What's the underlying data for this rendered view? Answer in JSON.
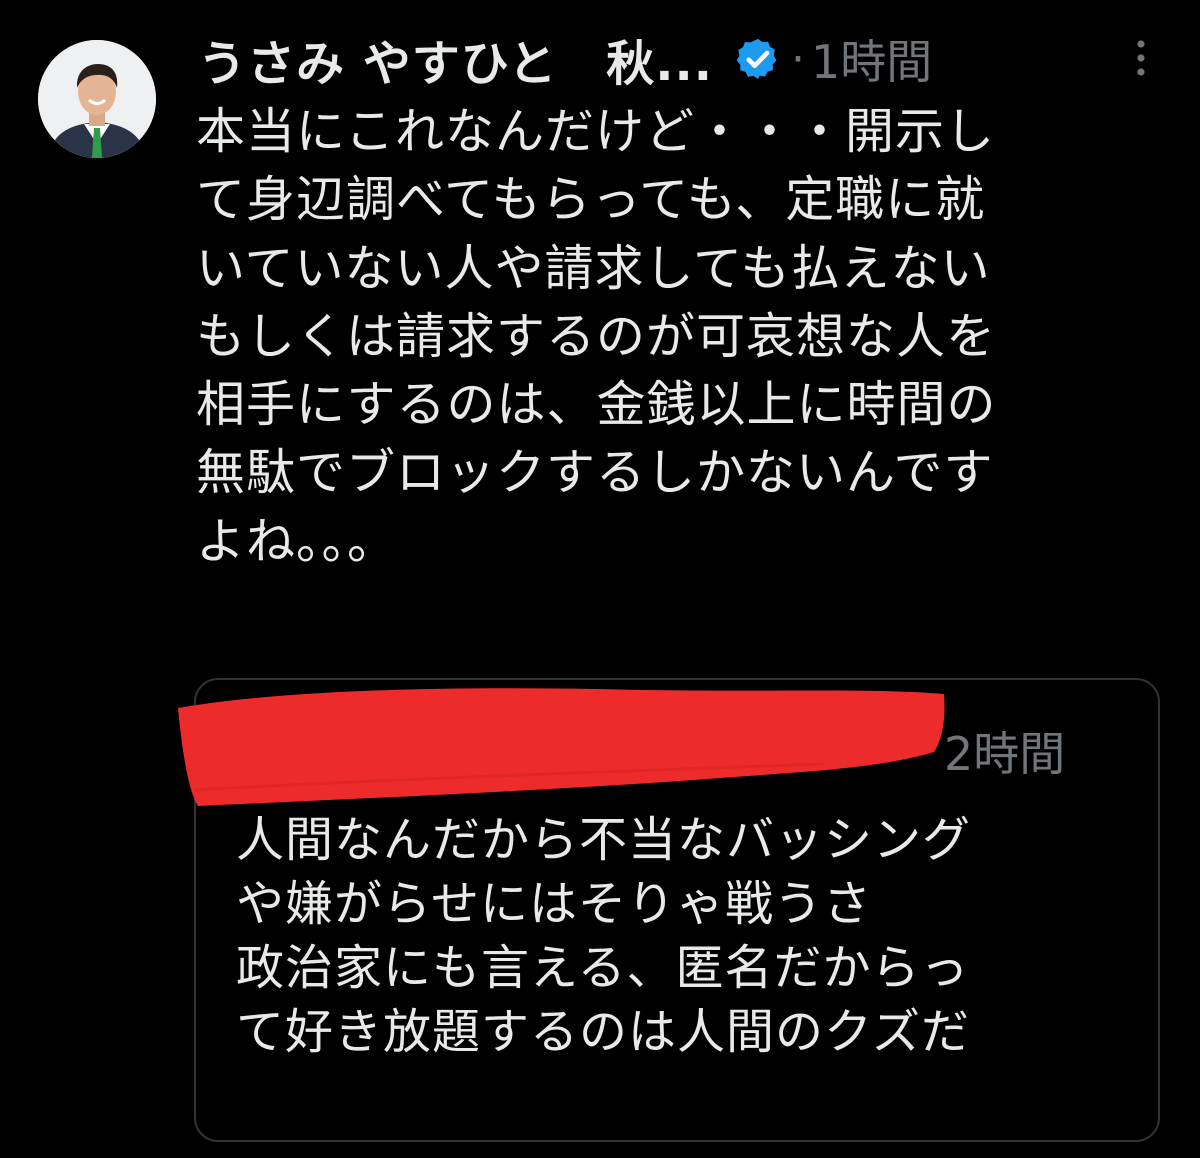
{
  "tweet": {
    "author": {
      "display_name": "うさみ やすひと　秋...",
      "avatar_icon": "avatar-photo",
      "verified_icon": "verified-badge-icon",
      "verified_color": "#1d9bf0"
    },
    "separator": "·",
    "timestamp": "1時間",
    "more_icon": "more-vertical-icon",
    "text": "本当にこれなんだけど・・・開示し\nて身辺調べてもらっても、定職に就\nいていない人や請求しても払えない\nもしくは請求するのが可哀想な人を\n相手にするのは、金銭以上に時間の\n無駄でブロックするしかないんです\nよね。。。"
  },
  "quoted_tweet": {
    "author_redaction_color": "#ee2b2b",
    "timestamp": "2時間",
    "text": "人間なんだから不当なバッシング\nや嫌がらせにはそりゃ戦うさ\n政治家にも言える、匿名だからっ\nて好き放題するのは人間のクズだ"
  },
  "colors": {
    "background": "#000000",
    "primary_text": "#e7e9ea",
    "secondary_text": "#71767b",
    "card_border": "#2f3336"
  }
}
